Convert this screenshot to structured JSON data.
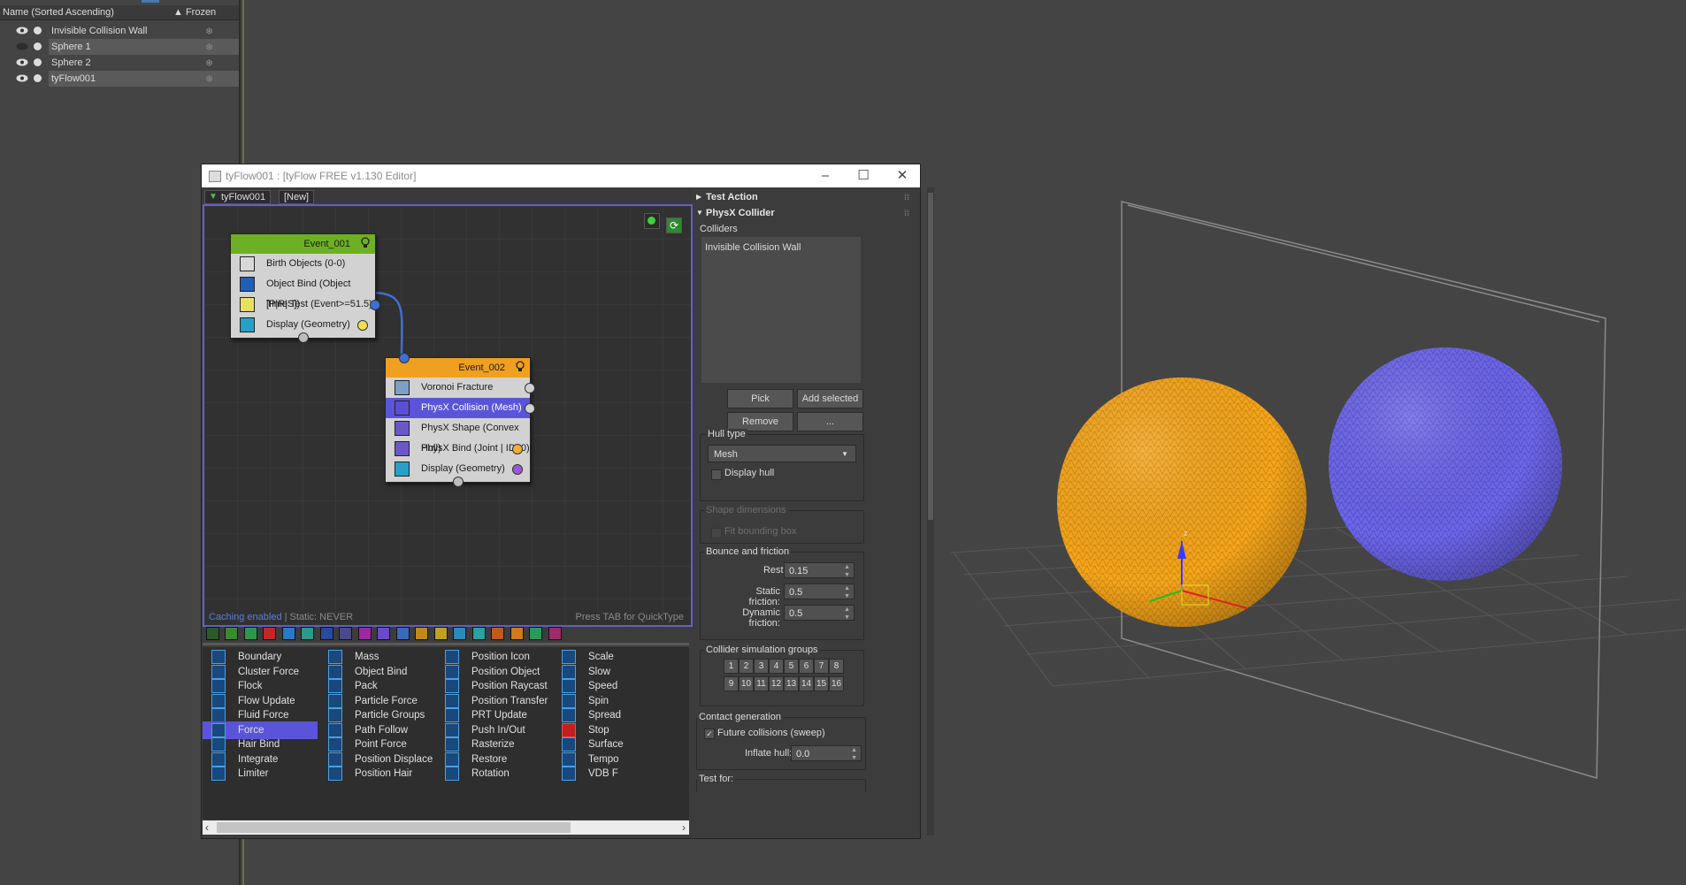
{
  "explorer": {
    "header_name": "Name (Sorted Ascending)",
    "header_frozen": "▲ Frozen",
    "rows": [
      {
        "name": "Invisible Collision Wall"
      },
      {
        "name": "Sphere 1"
      },
      {
        "name": "Sphere 2"
      },
      {
        "name": "tyFlow001"
      }
    ]
  },
  "editor": {
    "title": "tyFlow001 : [tyFlow FREE v1.130 Editor]",
    "tabs": [
      "tyFlow001",
      "[New]"
    ],
    "footer_left_bold": "Caching enabled",
    "footer_left_rest": " | Static: NEVER",
    "footer_right": "Press TAB for QuickType",
    "events": [
      {
        "name": "Event_001",
        "operators": [
          "Birth Objects (0-0)",
          "Object Bind (Object [P|R|S])",
          "Time Test (Event>=51.5)",
          "Display (Geometry)"
        ]
      },
      {
        "name": "Event_002",
        "operators": [
          "Voronoi Fracture",
          "PhysX Collision (Mesh)",
          "PhysX Shape (Convex Hull)",
          "PhysX Bind (Joint | ID: 0)",
          "Display (Geometry)"
        ]
      }
    ],
    "operator_columns": [
      [
        "Boundary",
        "Cluster Force",
        "Flock",
        "Flow Update",
        "Fluid Force",
        "Force",
        "Hair Bind",
        "Integrate",
        "Limiter"
      ],
      [
        "Mass",
        "Object Bind",
        "Pack",
        "Particle Force",
        "Particle Groups",
        "Path Follow",
        "Point Force",
        "Position Displace",
        "Position Hair"
      ],
      [
        "Position Icon",
        "Position Object",
        "Position Raycast",
        "Position Transfer",
        "PRT Update",
        "Push In/Out",
        "Rasterize",
        "Restore",
        "Rotation"
      ],
      [
        "Scale",
        "Slow",
        "Speed",
        "Spin",
        "Spread",
        "Stop",
        "Surface",
        "Tempo",
        "VDB F"
      ]
    ]
  },
  "props": {
    "test_action": "Test Action",
    "physx_collider": "PhysX Collider",
    "colliders_label": "Colliders",
    "colliders_list": [
      "Invisible Collision Wall"
    ],
    "pick": "Pick",
    "add_selected": "Add selected",
    "remove": "Remove",
    "ellipsis": "...",
    "hull_type_label": "Hull type",
    "hull_type_value": "Mesh",
    "display_hull": "Display hull",
    "shape_dimensions": "Shape dimensions",
    "fit_bounding_box": "Fit bounding box",
    "bounce_friction": "Bounce and friction",
    "restitution_label": "Restitution:",
    "restitution_value": "0.15",
    "static_friction_label": "Static friction:",
    "static_friction_value": "0.5",
    "dynamic_friction_label": "Dynamic friction:",
    "dynamic_friction_value": "0.5",
    "collider_groups": "Collider simulation groups",
    "groups": [
      "1",
      "2",
      "3",
      "4",
      "5",
      "6",
      "7",
      "8",
      "9",
      "10",
      "11",
      "12",
      "13",
      "14",
      "15",
      "16"
    ],
    "contact_generation": "Contact generation",
    "future_collisions": "Future collisions (sweep)",
    "inflate_hull_label": "Inflate hull:",
    "inflate_hull_value": "0.0",
    "test_for": "Test for:"
  },
  "colors": {
    "event1_header": "#6db024",
    "event2_header": "#f0a020",
    "selection": "#5a55d8",
    "graph_border": "#5f5fc8",
    "sphere_orange": "#f0a020",
    "sphere_purple": "#6a64e0"
  }
}
